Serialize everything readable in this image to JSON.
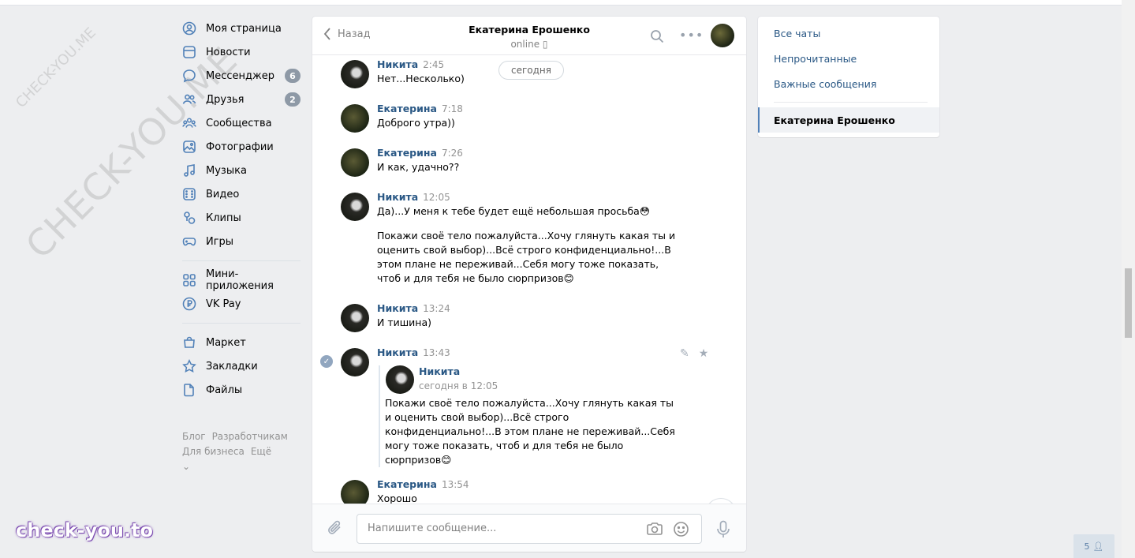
{
  "watermarks": {
    "big": "CHECK-YOU.ME",
    "small": "CHECK-YOU.ME",
    "brand": "check-you.to"
  },
  "nav": {
    "items": [
      {
        "label": "Моя страница",
        "icon": "user-icon"
      },
      {
        "label": "Новости",
        "icon": "news-icon"
      },
      {
        "label": "Мессенджер",
        "icon": "messenger-icon",
        "badge": "6"
      },
      {
        "label": "Друзья",
        "icon": "friends-icon",
        "badge": "2"
      },
      {
        "label": "Сообщества",
        "icon": "groups-icon"
      },
      {
        "label": "Фотографии",
        "icon": "photos-icon"
      },
      {
        "label": "Музыка",
        "icon": "music-icon"
      },
      {
        "label": "Видео",
        "icon": "video-icon"
      },
      {
        "label": "Клипы",
        "icon": "clips-icon"
      },
      {
        "label": "Игры",
        "icon": "games-icon"
      }
    ],
    "items2": [
      {
        "label": "Мини-приложения",
        "icon": "apps-icon"
      },
      {
        "label": "VK Pay",
        "icon": "vkpay-icon"
      }
    ],
    "items3": [
      {
        "label": "Маркет",
        "icon": "market-icon"
      },
      {
        "label": "Закладки",
        "icon": "bookmarks-icon"
      },
      {
        "label": "Файлы",
        "icon": "files-icon"
      }
    ],
    "footer": [
      "Блог",
      "Разработчикам",
      "Для бизнеса",
      "Ещё"
    ]
  },
  "chat": {
    "back_label": "Назад",
    "peer_name": "Екатерина Ерошенко",
    "peer_status": "online",
    "date_pill": "сегодня",
    "messages": [
      {
        "author": "Никита",
        "time": "2:45",
        "text": "Нет...Несколько)"
      },
      {
        "author": "Екатерина",
        "time": "7:18",
        "text": "Доброго утра))"
      },
      {
        "author": "Екатерина",
        "time": "7:26",
        "text": "И как, удачно??"
      },
      {
        "author": "Никита",
        "time": "12:05",
        "text": "Да)...У меня к тебе будет ещё небольшая просьба😳",
        "text2": "Покажи своё тело пожалуйста...Хочу глянуть какая ты и оценить свой выбор)...Всё строго конфиденциально!...В этом плане не переживай...Себя могу тоже показать, чтоб и для тебя не было сюрпризов😊"
      },
      {
        "author": "Никита",
        "time": "13:24",
        "text": "И тишина)"
      },
      {
        "author": "Никита",
        "time": "13:43",
        "fwd_author": "Никита",
        "fwd_date": "сегодня в 12:05",
        "fwd_text": "Покажи своё тело пожалуйста...Хочу глянуть какая ты и оценить свой выбор)...Всё строго конфиденциально!...В этом плане не переживай...Себя могу тоже показать, чтоб и для тебя не было сюрпризов😊"
      },
      {
        "author": "Екатерина",
        "time": "13:54",
        "text": "Хорошо"
      }
    ],
    "composer_placeholder": "Напишите сообщение..."
  },
  "right_panel": {
    "links": [
      "Все чаты",
      "Непрочитанные",
      "Важные сообщения"
    ],
    "active_chat": "Екатерина Ерошенко"
  },
  "online_count": "5",
  "colors": {
    "accent": "#5181b8",
    "link": "#2a5885",
    "badge": "#8e99a6",
    "bg": "#edeef0"
  }
}
